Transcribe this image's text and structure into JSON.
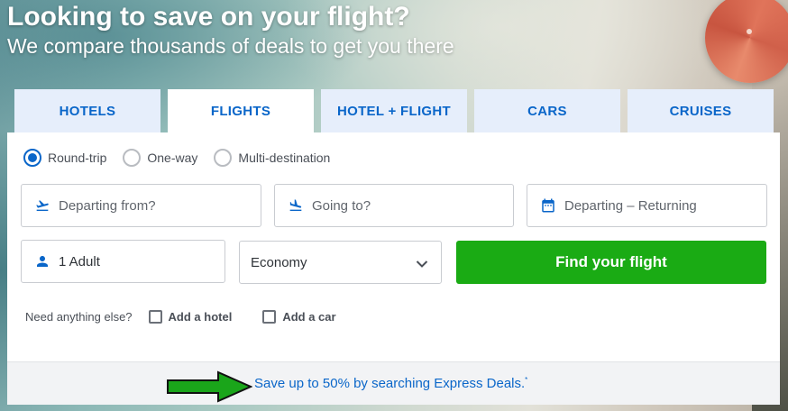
{
  "hero": {
    "title": "Looking to save on your flight?",
    "subtitle": "We compare thousands of deals to get you there"
  },
  "tabs": [
    {
      "label": "HOTELS",
      "active": false
    },
    {
      "label": "FLIGHTS",
      "active": true
    },
    {
      "label": "HOTEL + FLIGHT",
      "active": false
    },
    {
      "label": "CARS",
      "active": false
    },
    {
      "label": "CRUISES",
      "active": false
    }
  ],
  "trip_types": [
    {
      "label": "Round-trip",
      "checked": true
    },
    {
      "label": "One-way",
      "checked": false
    },
    {
      "label": "Multi-destination",
      "checked": false
    }
  ],
  "search": {
    "from_placeholder": "Departing from?",
    "to_placeholder": "Going to?",
    "dates_placeholder": "Departing – Returning",
    "travelers_value": "1 Adult",
    "cabin_value": "Economy",
    "submit_label": "Find your flight"
  },
  "extras": {
    "label": "Need anything else?",
    "options": [
      {
        "label": "Add a hotel",
        "checked": false
      },
      {
        "label": "Add a car",
        "checked": false
      }
    ]
  },
  "footer": {
    "deals_text": "Save up to 50% by searching Express Deals.",
    "deals_mark": "*"
  },
  "colors": {
    "brand_blue": "#0a66c9",
    "cta_green": "#1aab14",
    "annotation_arrow": "#1aa51a",
    "tab_inactive_bg": "#e6eefb"
  },
  "icons": {
    "from": "plane-takeoff-icon",
    "to": "plane-landing-icon",
    "dates": "calendar-icon",
    "travelers": "person-icon",
    "cabin_dropdown": "chevron-down-icon",
    "annotation": "arrow-right-icon"
  }
}
